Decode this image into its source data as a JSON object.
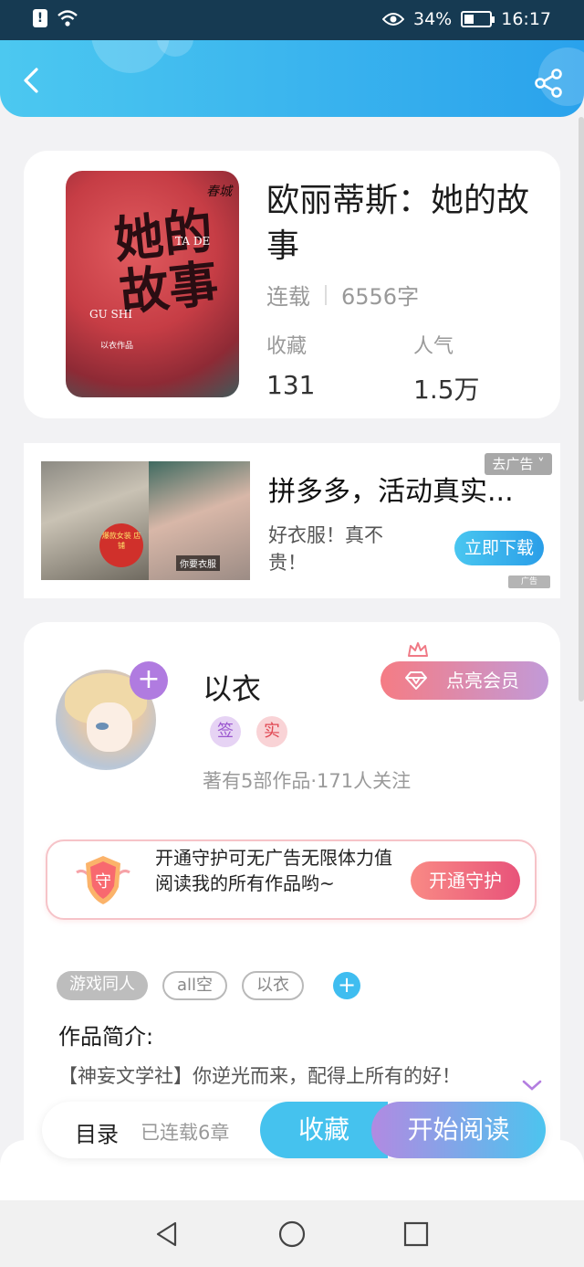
{
  "status_bar": {
    "battery": "34%",
    "time": "16:17",
    "battery_level": 0.34
  },
  "book": {
    "title": "欧丽蒂斯：她的故事",
    "status": "连载",
    "word_count": "6556字",
    "favorites_label": "收藏",
    "favorites_value": "131",
    "popularity_label": "人气",
    "popularity_value": "1.5万",
    "cover": {
      "title_art": "她的故事",
      "publisher": "春城",
      "pinyin_top": "TA DE",
      "pinyin_bottom": "GU SHI",
      "author_line": "以衣作品"
    }
  },
  "ad": {
    "title": "拼多多，活动真实...",
    "description": "好衣服！真不贵！",
    "download_label": "立即下载",
    "close_label": "去广告",
    "tag_label": "广告",
    "badge_text": "爆款女装 店铺",
    "caption": "你要衣服"
  },
  "author": {
    "name": "以衣",
    "badge_sign": "签",
    "badge_real": "实",
    "stats": "著有5部作品·171人关注",
    "vip_label": "点亮会员"
  },
  "guard": {
    "shield_text": "守",
    "text": "开通守护可无广告无限体力值阅读我的所有作品哟~",
    "button_label": "开通守护"
  },
  "tags": [
    "游戏同人",
    "all空",
    "以衣"
  ],
  "intro": {
    "label": "作品简介:",
    "text": "【神妄文学社】你逆光而来，配得上所有的好！"
  },
  "actions": {
    "toc_label": "目录",
    "chapters": "已连载6章",
    "favorite_label": "收藏",
    "read_label": "开始阅读"
  },
  "colors": {
    "accent_blue": "#45c2ee",
    "accent_purple": "#b18ae2",
    "vip_pink": "#f57c84"
  }
}
